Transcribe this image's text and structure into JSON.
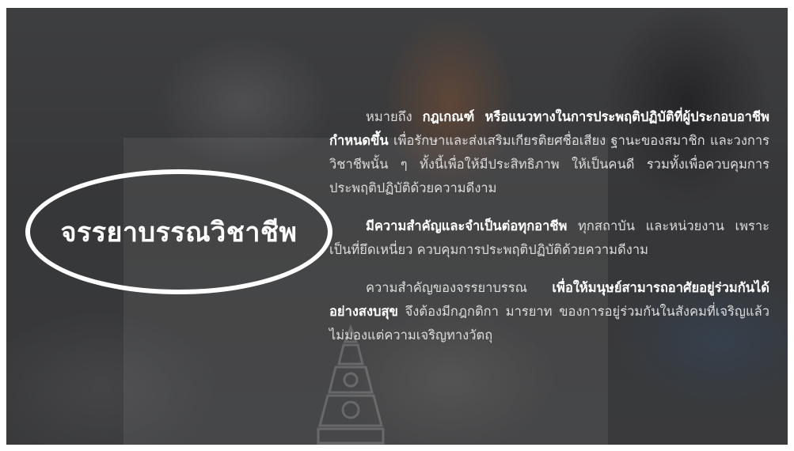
{
  "title": "จรรยาบรรณวิชาชีพ",
  "paragraphs": [
    {
      "lead": "หมายถึง ",
      "bold": "กฎเกณฑ์ หรือแนวทางในการประพฤติปฏิบัติที่ผู้ประกอบอาชีพกำหนดขึ้น",
      "rest": " เพื่อรักษาและส่งเสริมเกียรติยศชื่อเสียง ฐานะของสมาชิก และวงการวิชาชีพนั้น ๆ ทั้งนี้เพื่อให้มีประสิทธิภาพ ให้เป็นคนดี รวมทั้งเพื่อควบคุมการประพฤติปฏิบัติด้วยความดีงาม"
    },
    {
      "lead": "",
      "bold": "มีความสำคัญและจำเป็นต่อทุกอาชีพ",
      "rest": " ทุกสถาบัน และหน่วยงาน เพราะเป็นที่ยึดเหนี่ยว ควบคุมการประพฤติปฏิบัติด้วยความดีงาม"
    },
    {
      "lead": "ความสำคัญของจรรยาบรรณ ",
      "bold": "เพื่อให้มนุษย์สามารถอาศัยอยู่ร่วมกันได้อย่างสงบสุข",
      "rest": " จึงต้องมีกฎกติกา มารยาท ของการอยู่ร่วมกันในสังคมที่เจริญแล้วไม่มองแต่ความเจริญทางวัตถุ"
    }
  ],
  "colors": {
    "text": "#dcdcdc",
    "emphasis": "#ffffff",
    "oval": "#ffffff"
  }
}
